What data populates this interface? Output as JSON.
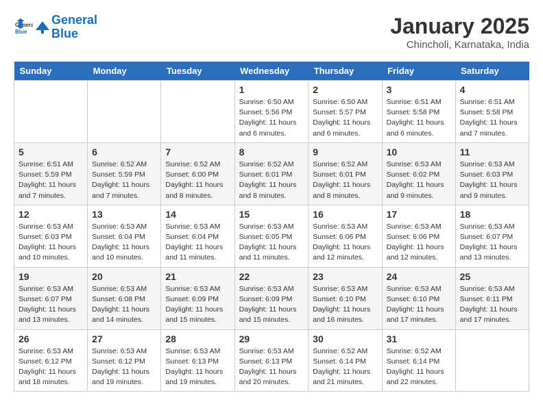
{
  "logo": {
    "line1": "General",
    "line2": "Blue"
  },
  "title": "January 2025",
  "subtitle": "Chincholi, Karnataka, India",
  "days_of_week": [
    "Sunday",
    "Monday",
    "Tuesday",
    "Wednesday",
    "Thursday",
    "Friday",
    "Saturday"
  ],
  "weeks": [
    [
      {
        "day": "",
        "info": ""
      },
      {
        "day": "",
        "info": ""
      },
      {
        "day": "",
        "info": ""
      },
      {
        "day": "1",
        "info": "Sunrise: 6:50 AM\nSunset: 5:56 PM\nDaylight: 11 hours and 6 minutes."
      },
      {
        "day": "2",
        "info": "Sunrise: 6:50 AM\nSunset: 5:57 PM\nDaylight: 11 hours and 6 minutes."
      },
      {
        "day": "3",
        "info": "Sunrise: 6:51 AM\nSunset: 5:58 PM\nDaylight: 11 hours and 6 minutes."
      },
      {
        "day": "4",
        "info": "Sunrise: 6:51 AM\nSunset: 5:58 PM\nDaylight: 11 hours and 7 minutes."
      }
    ],
    [
      {
        "day": "5",
        "info": "Sunrise: 6:51 AM\nSunset: 5:59 PM\nDaylight: 11 hours and 7 minutes."
      },
      {
        "day": "6",
        "info": "Sunrise: 6:52 AM\nSunset: 5:59 PM\nDaylight: 11 hours and 7 minutes."
      },
      {
        "day": "7",
        "info": "Sunrise: 6:52 AM\nSunset: 6:00 PM\nDaylight: 11 hours and 8 minutes."
      },
      {
        "day": "8",
        "info": "Sunrise: 6:52 AM\nSunset: 6:01 PM\nDaylight: 11 hours and 8 minutes."
      },
      {
        "day": "9",
        "info": "Sunrise: 6:52 AM\nSunset: 6:01 PM\nDaylight: 11 hours and 8 minutes."
      },
      {
        "day": "10",
        "info": "Sunrise: 6:53 AM\nSunset: 6:02 PM\nDaylight: 11 hours and 9 minutes."
      },
      {
        "day": "11",
        "info": "Sunrise: 6:53 AM\nSunset: 6:03 PM\nDaylight: 11 hours and 9 minutes."
      }
    ],
    [
      {
        "day": "12",
        "info": "Sunrise: 6:53 AM\nSunset: 6:03 PM\nDaylight: 11 hours and 10 minutes."
      },
      {
        "day": "13",
        "info": "Sunrise: 6:53 AM\nSunset: 6:04 PM\nDaylight: 11 hours and 10 minutes."
      },
      {
        "day": "14",
        "info": "Sunrise: 6:53 AM\nSunset: 6:04 PM\nDaylight: 11 hours and 11 minutes."
      },
      {
        "day": "15",
        "info": "Sunrise: 6:53 AM\nSunset: 6:05 PM\nDaylight: 11 hours and 11 minutes."
      },
      {
        "day": "16",
        "info": "Sunrise: 6:53 AM\nSunset: 6:06 PM\nDaylight: 11 hours and 12 minutes."
      },
      {
        "day": "17",
        "info": "Sunrise: 6:53 AM\nSunset: 6:06 PM\nDaylight: 11 hours and 12 minutes."
      },
      {
        "day": "18",
        "info": "Sunrise: 6:53 AM\nSunset: 6:07 PM\nDaylight: 11 hours and 13 minutes."
      }
    ],
    [
      {
        "day": "19",
        "info": "Sunrise: 6:53 AM\nSunset: 6:07 PM\nDaylight: 11 hours and 13 minutes."
      },
      {
        "day": "20",
        "info": "Sunrise: 6:53 AM\nSunset: 6:08 PM\nDaylight: 11 hours and 14 minutes."
      },
      {
        "day": "21",
        "info": "Sunrise: 6:53 AM\nSunset: 6:09 PM\nDaylight: 11 hours and 15 minutes."
      },
      {
        "day": "22",
        "info": "Sunrise: 6:53 AM\nSunset: 6:09 PM\nDaylight: 11 hours and 15 minutes."
      },
      {
        "day": "23",
        "info": "Sunrise: 6:53 AM\nSunset: 6:10 PM\nDaylight: 11 hours and 16 minutes."
      },
      {
        "day": "24",
        "info": "Sunrise: 6:53 AM\nSunset: 6:10 PM\nDaylight: 11 hours and 17 minutes."
      },
      {
        "day": "25",
        "info": "Sunrise: 6:53 AM\nSunset: 6:11 PM\nDaylight: 11 hours and 17 minutes."
      }
    ],
    [
      {
        "day": "26",
        "info": "Sunrise: 6:53 AM\nSunset: 6:12 PM\nDaylight: 11 hours and 18 minutes."
      },
      {
        "day": "27",
        "info": "Sunrise: 6:53 AM\nSunset: 6:12 PM\nDaylight: 11 hours and 19 minutes."
      },
      {
        "day": "28",
        "info": "Sunrise: 6:53 AM\nSunset: 6:13 PM\nDaylight: 11 hours and 19 minutes."
      },
      {
        "day": "29",
        "info": "Sunrise: 6:53 AM\nSunset: 6:13 PM\nDaylight: 11 hours and 20 minutes."
      },
      {
        "day": "30",
        "info": "Sunrise: 6:52 AM\nSunset: 6:14 PM\nDaylight: 11 hours and 21 minutes."
      },
      {
        "day": "31",
        "info": "Sunrise: 6:52 AM\nSunset: 6:14 PM\nDaylight: 11 hours and 22 minutes."
      },
      {
        "day": "",
        "info": ""
      }
    ]
  ]
}
